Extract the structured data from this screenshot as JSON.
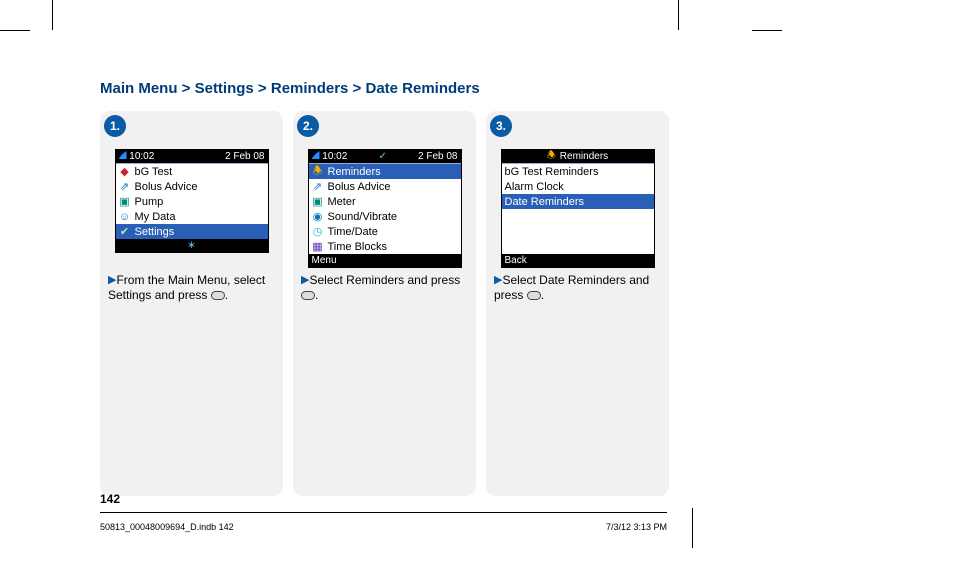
{
  "heading": "Main Menu > Settings > Reminders > Date Reminders",
  "page_number": "142",
  "footer": {
    "file": "50813_00048009694_D.indb   142",
    "stamp": "7/3/12   3:13 PM"
  },
  "steps": [
    {
      "badge": "1.",
      "bar": {
        "time": "10:02",
        "center": "",
        "date": "2 Feb 08"
      },
      "rows": [
        {
          "icon": "drop-icon",
          "ico_color": "#c62828",
          "label": "bG Test"
        },
        {
          "icon": "syringe-icon",
          "ico_color": "#0277bd",
          "label": "Bolus Advice"
        },
        {
          "icon": "plug-icon",
          "ico_color": "#00897b",
          "label": "Pump"
        },
        {
          "icon": "person-icon",
          "ico_color": "#1565c0",
          "label": "My Data"
        },
        {
          "icon": "check-icon",
          "ico_color": "#2e7d32",
          "label": "Settings",
          "selected": true
        }
      ],
      "foot_left": "",
      "foot_center_bt": true,
      "instr": "From the Main Menu, select Settings and press"
    },
    {
      "badge": "2.",
      "bar": {
        "time": "10:02",
        "center": "✓",
        "date": "2 Feb 08"
      },
      "rows": [
        {
          "icon": "bell-icon",
          "ico_color": "#f2b100",
          "label": "Reminders",
          "selected": true
        },
        {
          "icon": "syringe-icon",
          "ico_color": "#0277bd",
          "label": "Bolus Advice"
        },
        {
          "icon": "meter-icon",
          "ico_color": "#00897b",
          "label": "Meter"
        },
        {
          "icon": "speaker-icon",
          "ico_color": "#0277bd",
          "label": "Sound/Vibrate"
        },
        {
          "icon": "globe-icon",
          "ico_color": "#00bcd4",
          "label": "Time/Date"
        },
        {
          "icon": "blocks-icon",
          "ico_color": "#5e35b1",
          "label": "Time Blocks"
        }
      ],
      "foot_left": "Menu",
      "foot_center_bt": false,
      "instr": "Select Reminders and press"
    },
    {
      "badge": "3.",
      "bar_title": "Reminders",
      "bar_icon": "bell-icon",
      "rows": [
        {
          "label": "bG Test Reminders"
        },
        {
          "label": "Alarm Clock"
        },
        {
          "label": "Date Reminders",
          "selected": true
        }
      ],
      "empty": true,
      "foot_left": "Back",
      "foot_center_bt": false,
      "instr": "Select Date Reminders and press"
    }
  ]
}
